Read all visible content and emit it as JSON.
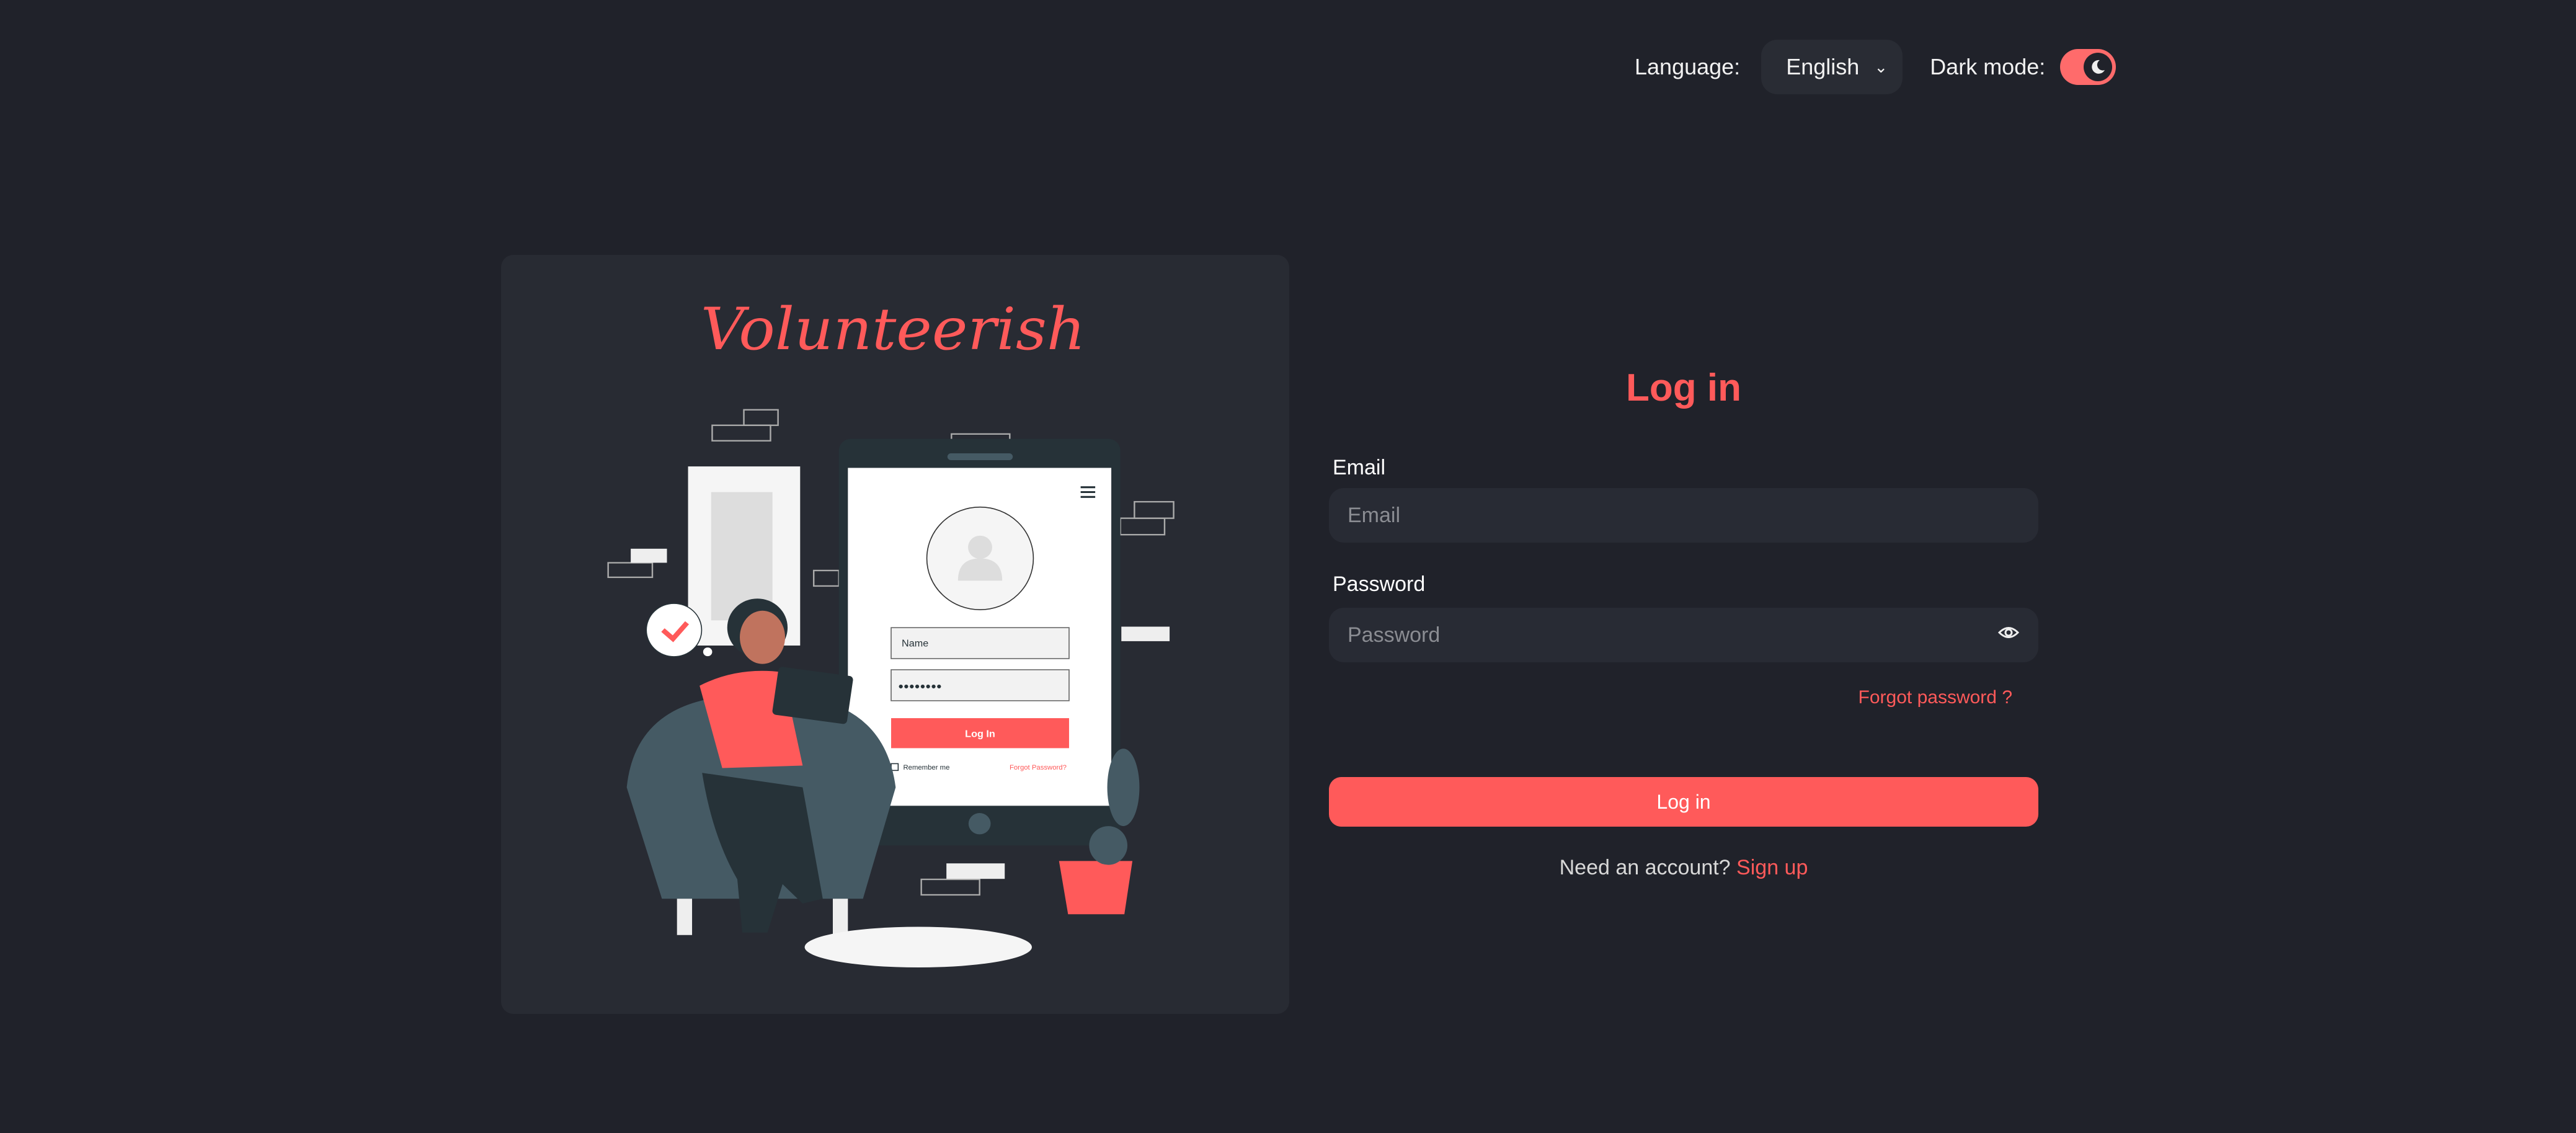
{
  "topbar": {
    "language_label": "Language:",
    "language_value": "English",
    "dark_mode_label": "Dark mode:",
    "dark_mode_on": true
  },
  "illustration": {
    "logo_text": "Volunteerish",
    "name_field": "Name",
    "password_dots": "●●●●●●●●",
    "login_button": "Log In",
    "remember_me": "Remember me",
    "forgot_password": "Forgot Password?"
  },
  "form": {
    "title": "Log in",
    "email_label": "Email",
    "email_placeholder": "Email",
    "password_label": "Password",
    "password_placeholder": "Password",
    "forgot_link": "Forgot password ?",
    "submit_label": "Log in",
    "signup_prompt": "Need an account?",
    "signup_link": "Sign up"
  },
  "colors": {
    "accent": "#ff5a5a",
    "background": "#20222a",
    "card": "#282b33"
  }
}
